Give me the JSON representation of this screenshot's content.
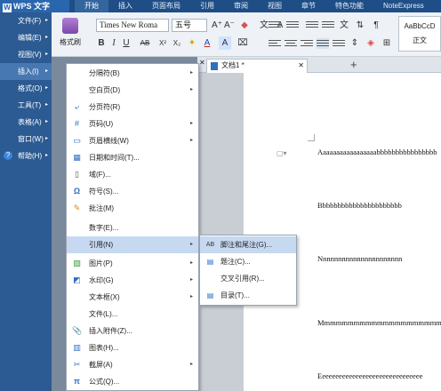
{
  "app": {
    "logo": "WPS 文字",
    "logo_glyph": "W"
  },
  "tabs": [
    "开始",
    "插入",
    "页面布局",
    "引用",
    "审阅",
    "视图",
    "章节",
    "特色功能",
    "NoteExpress"
  ],
  "ribbon": {
    "format_painter": "格式刷",
    "font_name": "Times New Roma",
    "font_size": "五号",
    "grow": "A⁺",
    "shrink": "A⁻",
    "bold": "B",
    "italic": "I",
    "underline": "U",
    "strike": "AB",
    "superscript": "X²",
    "subscript": "X₂",
    "style_sample": "AaBbCcD",
    "style_name": "正文"
  },
  "left_menu": [
    {
      "label": "文件(F)",
      "arrow": "▸"
    },
    {
      "label": "编辑(E)",
      "arrow": "▸"
    },
    {
      "label": "视图(V)",
      "arrow": "▸"
    },
    {
      "label": "插入(I)",
      "arrow": "▸"
    },
    {
      "label": "格式(O)",
      "arrow": "▸"
    },
    {
      "label": "工具(T)",
      "arrow": "▸"
    },
    {
      "label": "表格(A)",
      "arrow": "▸"
    },
    {
      "label": "窗口(W)",
      "arrow": "▸"
    },
    {
      "label": "帮助(H)",
      "arrow": "▸"
    }
  ],
  "insert_menu": [
    {
      "label": "分隔符(B)",
      "icon": "",
      "sub": "▸"
    },
    {
      "label": "空白页(D)",
      "icon": "",
      "sub": "▸"
    },
    {
      "label": "分页符(R)",
      "icon": "⤶",
      "sub": ""
    },
    {
      "label": "页码(U)",
      "icon": "#",
      "sub": "▸"
    },
    {
      "label": "页眉横线(W)",
      "icon": "▭",
      "sub": "▸"
    },
    {
      "label": "日期和时间(T)...",
      "icon": "▦",
      "sub": ""
    },
    {
      "label": "域(F)...",
      "icon": "▯",
      "sub": ""
    },
    {
      "label": "符号(S)...",
      "icon": "Ω",
      "sub": ""
    },
    {
      "label": "批注(M)",
      "icon": "✎",
      "sub": ""
    },
    {
      "label": "数字(E)...",
      "icon": "",
      "sub": ""
    },
    {
      "label": "引用(N)",
      "icon": "",
      "sub": "▸"
    },
    {
      "label": "图片(P)",
      "icon": "▨",
      "sub": "▸"
    },
    {
      "label": "水印(G)",
      "icon": "◩",
      "sub": "▸"
    },
    {
      "label": "文本框(X)",
      "icon": "",
      "sub": "▸"
    },
    {
      "label": "文件(L)...",
      "icon": "",
      "sub": ""
    },
    {
      "label": "插入附件(Z)...",
      "icon": "📎",
      "sub": ""
    },
    {
      "label": "图表(H)...",
      "icon": "▥",
      "sub": ""
    },
    {
      "label": "截屏(A)",
      "icon": "✂",
      "sub": "▸"
    },
    {
      "label": "公式(Q)...",
      "icon": "π",
      "sub": ""
    }
  ],
  "reference_submenu": [
    {
      "label": "脚注和尾注(G)...",
      "icon": "AB"
    },
    {
      "label": "题注(C)...",
      "icon": "▤"
    },
    {
      "label": "交叉引用(R)...",
      "icon": ""
    },
    {
      "label": "目录(T)...",
      "icon": "▤"
    }
  ],
  "document": {
    "tab_title": "文档1 *",
    "tab_close": "✕",
    "tab_close_left": "✕",
    "new_tab": "+",
    "lines": [
      "Aaaaaaaaaaaaaaaaabbbbbbbbbbbbbbbb",
      "Bbbbbbbbbbbbbbbbbbbbbb",
      "Nnnnnnnnnnnnnnnnnnnnnn",
      "Mmmmmmmmmmmmmmmmmmmmmmm",
      "Eeeeeeeeeeeeeeeeeeeeeeeeeeeeeee"
    ]
  }
}
